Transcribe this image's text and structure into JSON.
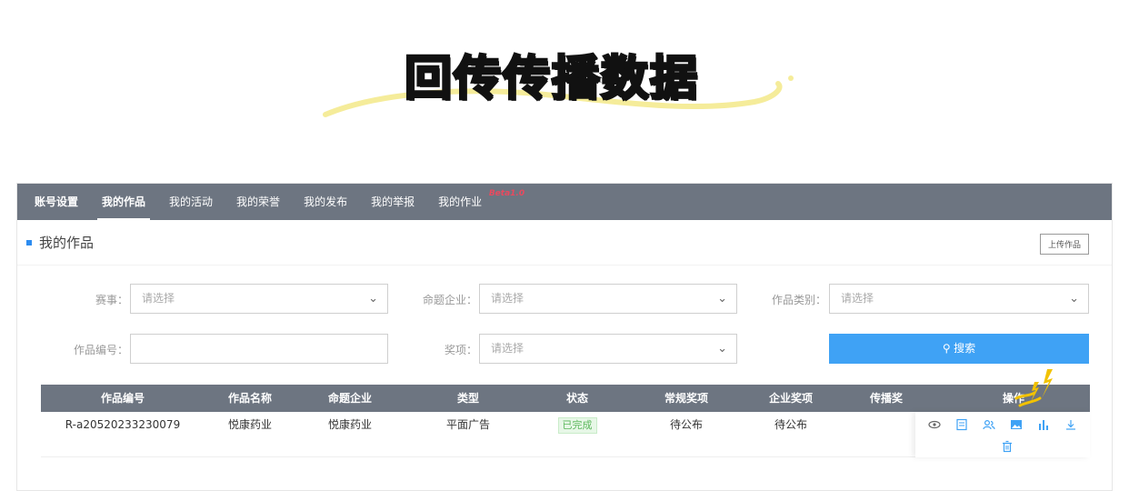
{
  "banner": {
    "title": "回传传播数据"
  },
  "nav": {
    "tabs": [
      {
        "label": "账号设置"
      },
      {
        "label": "我的作品"
      },
      {
        "label": "我的活动"
      },
      {
        "label": "我的荣誉"
      },
      {
        "label": "我的发布"
      },
      {
        "label": "我的举报"
      },
      {
        "label": "我的作业"
      }
    ],
    "beta_label": "Beta1.0"
  },
  "section": {
    "title": "我的作品",
    "upload_label": "上传作品"
  },
  "filters": {
    "competition_label": "赛事：",
    "competition_value": "请选择",
    "company_label": "命题企业：",
    "company_value": "请选择",
    "category_label": "作品类别：",
    "category_value": "请选择",
    "work_no_label": "作品编号：",
    "work_no_value": "",
    "award_label": "奖项：",
    "award_value": "请选择",
    "search_label": "搜索"
  },
  "table": {
    "headers": [
      "作品编号",
      "作品名称",
      "命题企业",
      "类型",
      "状态",
      "常规奖项",
      "企业奖项",
      "传播奖",
      "操作"
    ],
    "rows": [
      {
        "work_no": "R-a20520233230079",
        "name": "悦康药业",
        "company": "悦康药业",
        "type": "平面广告",
        "status": "已完成",
        "regular_award": "待公布",
        "company_award": "待公布",
        "spread_award": ""
      }
    ]
  },
  "icons": [
    "chevron-down-icon",
    "search-icon",
    "eye-icon",
    "document-icon",
    "users-icon",
    "image-icon",
    "bar-chart-icon",
    "download-icon",
    "trash-icon",
    "sparkle-icon"
  ],
  "colors": {
    "nav_bg": "#6d7581",
    "accent": "#3fa2f5",
    "highlight": "#f5e98a"
  }
}
